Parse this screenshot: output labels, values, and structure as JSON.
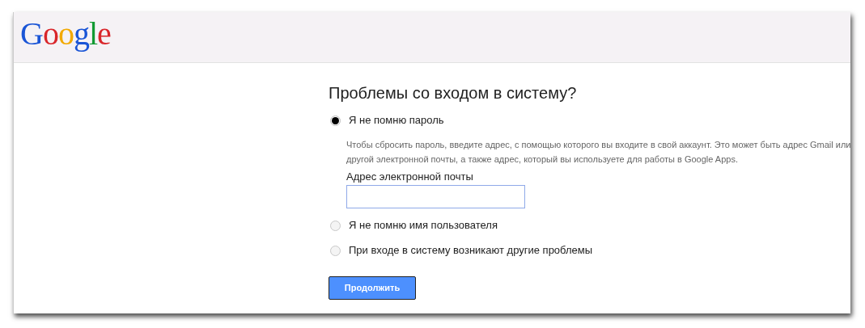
{
  "header": {
    "logo": "Google"
  },
  "title": "Проблемы со входом в систему?",
  "options": [
    {
      "label": "Я не помню пароль",
      "selected": true,
      "description": "Чтобы сбросить пароль, введите адрес, с помощью которого вы входите в свой аккаунт. Это может быть адрес Gmail или другой электронной почты, а также адрес, который вы используете для работы в Google Apps.",
      "field_label": "Адрес электронной почты"
    },
    {
      "label": "Я не помню имя пользователя",
      "selected": false
    },
    {
      "label": "При входе в систему возникают другие проблемы",
      "selected": false
    }
  ],
  "buttons": [
    "Продолжить"
  ]
}
